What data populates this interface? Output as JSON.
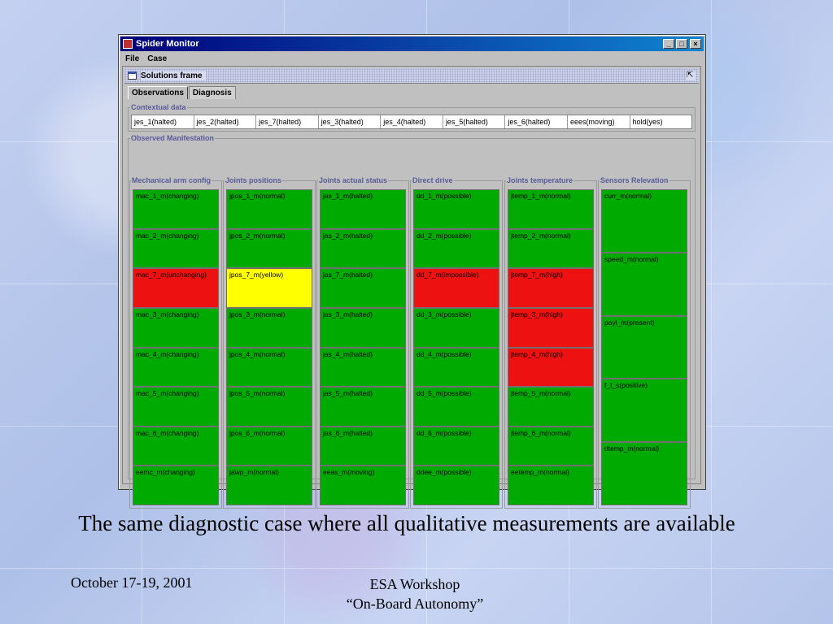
{
  "window": {
    "title": "Spider Monitor",
    "min": "_",
    "max": "□",
    "close": "×"
  },
  "menu": [
    "File",
    "Case"
  ],
  "frame": {
    "title": "Solutions frame"
  },
  "tabs": [
    "Observations",
    "Diagnosis"
  ],
  "contextual": {
    "legend": "Contextual data",
    "items": [
      "jes_1(halted)",
      "jes_2(halted)",
      "jes_7(halted)",
      "jes_3(halted)",
      "jes_4(halted)",
      "jes_5(halted)",
      "jes_6(halted)",
      "eees(moving)",
      "hold(yes)"
    ]
  },
  "observed": {
    "legend": "Observed Manifestation",
    "columns": [
      {
        "title": "Mechanical arm config",
        "cells": [
          {
            "text": "mac_1_m(changing)",
            "color": "green"
          },
          {
            "text": "mac_2_m(changing)",
            "color": "green"
          },
          {
            "text": "mac_7_m(unchanging)",
            "color": "red"
          },
          {
            "text": "mac_3_m(changing)",
            "color": "green"
          },
          {
            "text": "mac_4_m(changing)",
            "color": "green"
          },
          {
            "text": "mac_5_m(changing)",
            "color": "green"
          },
          {
            "text": "mac_6_m(changing)",
            "color": "green"
          },
          {
            "text": "eemc_m(changing)",
            "color": "green"
          }
        ]
      },
      {
        "title": "Joints positions",
        "cells": [
          {
            "text": "jpos_1_m(normal)",
            "color": "green"
          },
          {
            "text": "jpos_2_m(normal)",
            "color": "green"
          },
          {
            "text": "jpos_7_m(yellow)",
            "color": "yellow"
          },
          {
            "text": "jpos_3_m(normal)",
            "color": "green"
          },
          {
            "text": "jpos_4_m(normal)",
            "color": "green"
          },
          {
            "text": "jpos_5_m(normal)",
            "color": "green"
          },
          {
            "text": "jpos_6_m(normal)",
            "color": "green"
          },
          {
            "text": "jawp_m(normal)",
            "color": "green"
          }
        ]
      },
      {
        "title": "Joints actual status",
        "cells": [
          {
            "text": "jas_1_m(halted)",
            "color": "green"
          },
          {
            "text": "jas_2_m(halted)",
            "color": "green"
          },
          {
            "text": "jas_7_m(halted)",
            "color": "green"
          },
          {
            "text": "jas_3_m(halted)",
            "color": "green"
          },
          {
            "text": "jas_4_m(halted)",
            "color": "green"
          },
          {
            "text": "jas_5_m(halted)",
            "color": "green"
          },
          {
            "text": "jas_6_m(halted)",
            "color": "green"
          },
          {
            "text": "eeas_m(moving)",
            "color": "green"
          }
        ]
      },
      {
        "title": "Direct drive",
        "cells": [
          {
            "text": "dd_1_m(possible)",
            "color": "green"
          },
          {
            "text": "dd_2_m(possible)",
            "color": "green"
          },
          {
            "text": "dd_7_m(impossible)",
            "color": "red"
          },
          {
            "text": "dd_3_m(possible)",
            "color": "green"
          },
          {
            "text": "dd_4_m(possible)",
            "color": "green"
          },
          {
            "text": "dd_5_m(possible)",
            "color": "green"
          },
          {
            "text": "dd_6_m(possible)",
            "color": "green"
          },
          {
            "text": "ddee_m(possible)",
            "color": "green"
          }
        ]
      },
      {
        "title": "Joints temperature",
        "cells": [
          {
            "text": "jtemp_1_m(normal)",
            "color": "green"
          },
          {
            "text": "jtemp_2_m(normal)",
            "color": "green"
          },
          {
            "text": "jtemp_7_m(high)",
            "color": "red"
          },
          {
            "text": "jtemp_3_m(high)",
            "color": "red"
          },
          {
            "text": "jtemp_4_m(high)",
            "color": "red"
          },
          {
            "text": "jtemp_5_m(normal)",
            "color": "green"
          },
          {
            "text": "jtemp_6_m(normal)",
            "color": "green"
          },
          {
            "text": "eetemp_m(normal)",
            "color": "green"
          }
        ]
      },
      {
        "title": "Sensors Relevation",
        "cells": [
          {
            "text": "curr_m(normal)",
            "color": "green"
          },
          {
            "text": "speed_m(normal)",
            "color": "green"
          },
          {
            "text": "payl_m(present)",
            "color": "green"
          },
          {
            "text": "f_t_s(positive)",
            "color": "green"
          },
          {
            "text": "dtemp_m(normal)",
            "color": "green"
          }
        ]
      }
    ]
  },
  "caption": "The same diagnostic case where all qualitative measurements are available",
  "footer": {
    "date": "October 17-19, 2001",
    "event_line1": "ESA Workshop",
    "event_line2": "“On-Board Autonomy”"
  }
}
